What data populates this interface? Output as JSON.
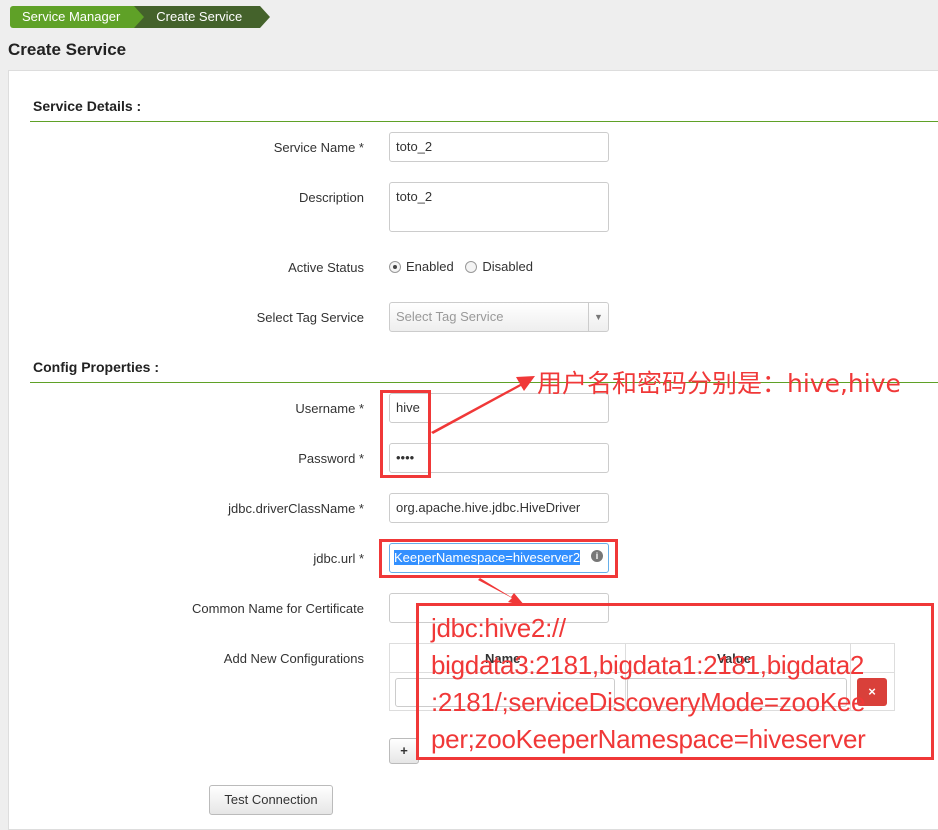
{
  "breadcrumb": [
    "Service Manager",
    "Create Service"
  ],
  "page_title": "Create Service",
  "service_details": {
    "heading": "Service Details :",
    "service_name_label": "Service Name *",
    "service_name": "toto_2",
    "description_label": "Description",
    "description": "toto_2",
    "active_status_label": "Active Status",
    "enabled": "Enabled",
    "disabled": "Disabled",
    "selected": "Enabled",
    "tag_label": "Select Tag Service",
    "tag_placeholder": "Select Tag Service"
  },
  "config": {
    "heading": "Config Properties :",
    "username_label": "Username *",
    "username": "hive",
    "password_label": "Password *",
    "password": "••••",
    "driver_label": "jdbc.driverClassName *",
    "driver": "org.apache.hive.jdbc.HiveDriver",
    "url_label": "jdbc.url *",
    "url": "KeeperNamespace=hiveserver2",
    "cn_label": "Common Name for Certificate",
    "cn": "",
    "add_label": "Add New Configurations",
    "col_name": "Name",
    "col_value": "Value",
    "add_button": "+",
    "remove_button": "×"
  },
  "test_connection": "Test Connection",
  "annotations": {
    "credentials": "用户名和密码分别是：hive,hive",
    "url": [
      "jdbc:hive2://",
      "bigdata3:2181,bigdata1:2181,bigdata2",
      ":2181/;serviceDiscoveryMode=zooKee",
      "per;zooKeeperNamespace=hiveserver"
    ],
    "color": "#f03838"
  }
}
